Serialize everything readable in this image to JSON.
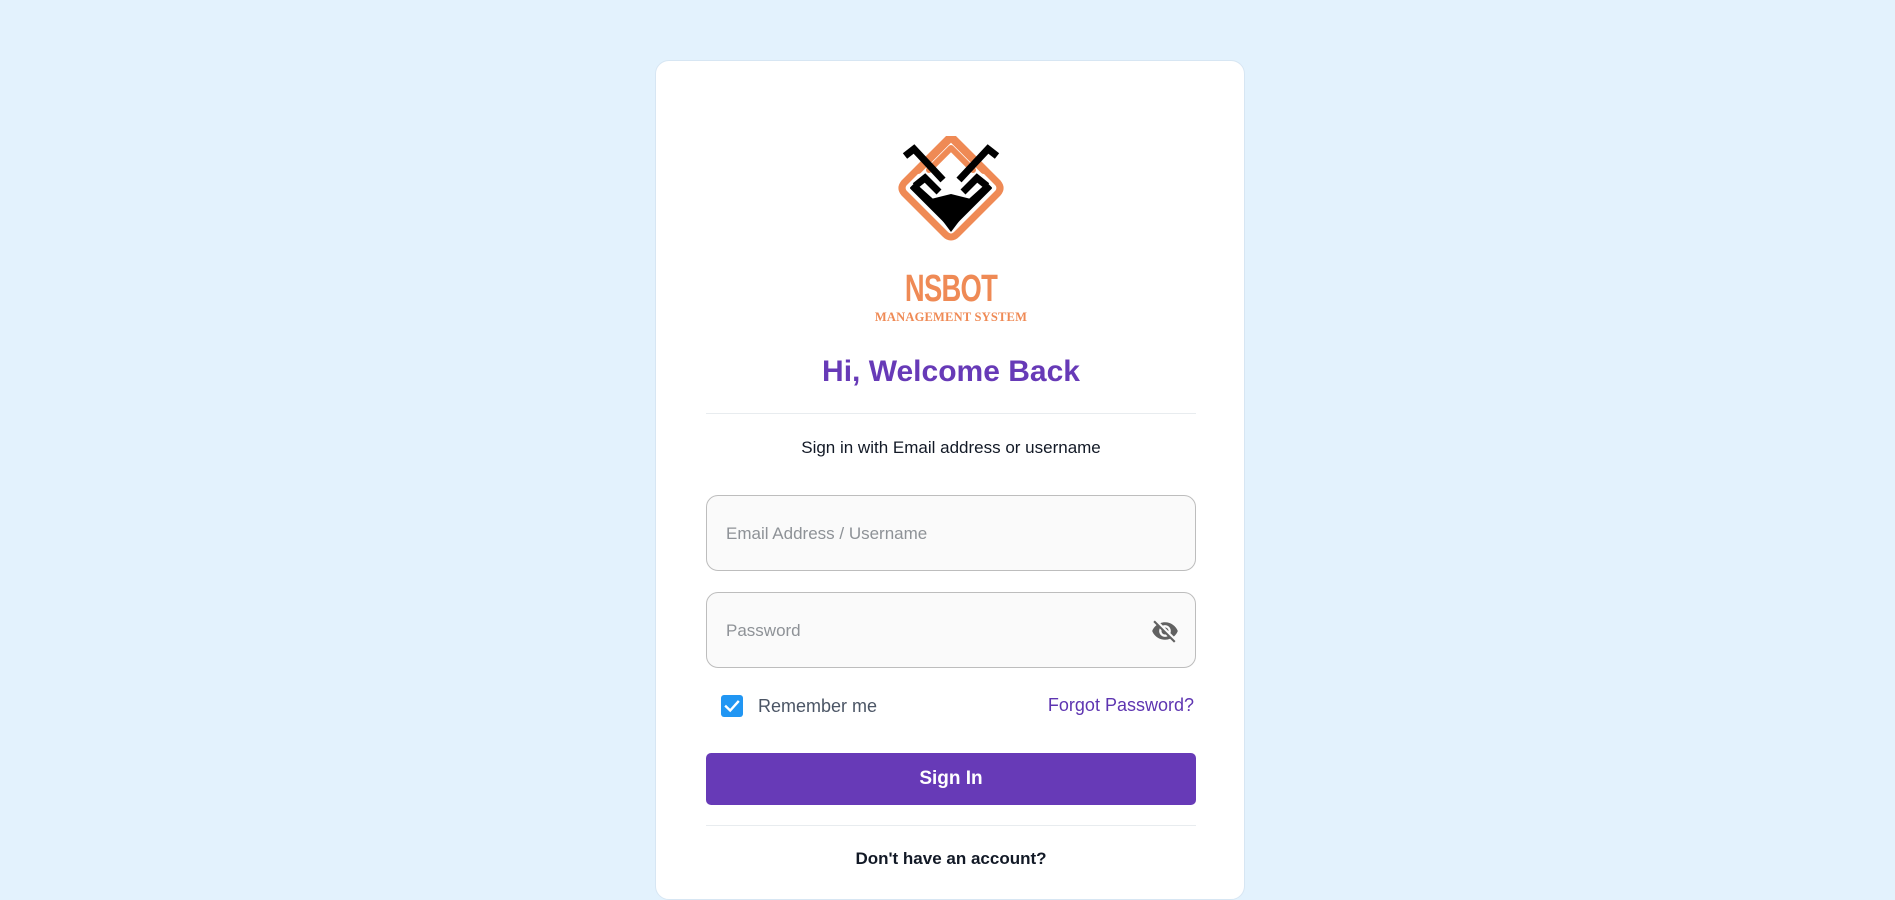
{
  "brand": {
    "name": "NSBOT",
    "tagline": "MANAGEMENT SYSTEM"
  },
  "login": {
    "title": "Hi, Welcome Back",
    "subtitle": "Sign in with Email address or username",
    "email_placeholder": "Email Address / Username",
    "password_placeholder": "Password",
    "remember_label": "Remember me",
    "remember_checked": true,
    "forgot_label": "Forgot Password?",
    "signin_label": "Sign In",
    "signup_prompt": "Don't have an account?"
  },
  "icons": {
    "password_toggle": "visibility-off-icon",
    "checkbox": "check-icon",
    "logo": "deer-head-logo"
  },
  "colors": {
    "background": "#e3f2fd",
    "accent": "#673ab7",
    "logo_orange": "#ef8a55",
    "checkbox": "#2196f3"
  }
}
